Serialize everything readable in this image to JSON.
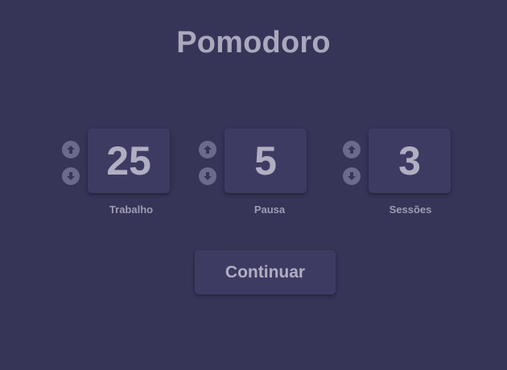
{
  "app": {
    "title": "Pomodoro"
  },
  "timers": [
    {
      "value": "25",
      "label": "Trabalho",
      "up_icon": "arrow-up-icon",
      "down_icon": "arrow-down-icon"
    },
    {
      "value": "5",
      "label": "Pausa",
      "up_icon": "arrow-up-icon",
      "down_icon": "arrow-down-icon"
    },
    {
      "value": "3",
      "label": "Sessões",
      "up_icon": "arrow-up-icon",
      "down_icon": "arrow-down-icon"
    }
  ],
  "actions": {
    "continue_label": "Continuar"
  },
  "colors": {
    "background": "#363457",
    "panel": "#3e3b63",
    "text": "#b0afc2",
    "arrow": "#6b6a8d"
  }
}
